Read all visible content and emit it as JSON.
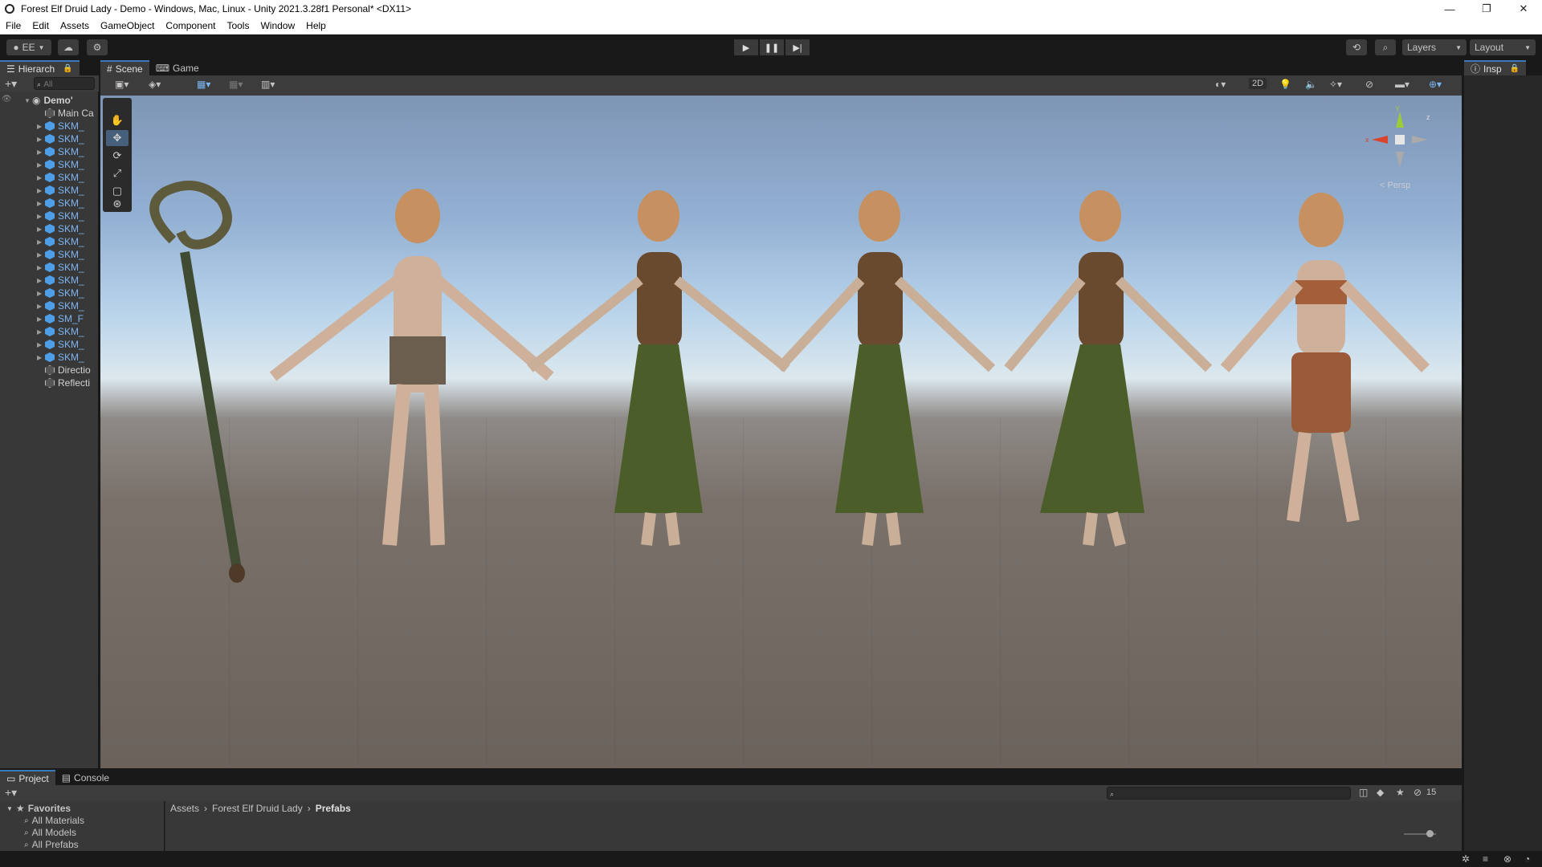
{
  "window": {
    "title": "Forest Elf Druid Lady - Demo - Windows, Mac, Linux - Unity 2021.3.28f1 Personal* <DX11>",
    "controls": [
      "—",
      "❐",
      "✕"
    ]
  },
  "menu": [
    "File",
    "Edit",
    "Assets",
    "GameObject",
    "Component",
    "Tools",
    "Window",
    "Help"
  ],
  "toolbar": {
    "account": "EE",
    "play": "▶",
    "pause": "❚❚",
    "step": "▶|",
    "layers": "Layers",
    "layout": "Layout"
  },
  "hierarchy": {
    "tab": "Hierarch",
    "search_placeholder": "All",
    "root": "Demo'",
    "items": [
      {
        "label": "Main Ca",
        "kind": "gray",
        "expandable": false
      },
      {
        "label": "SKM_",
        "kind": "blue",
        "expandable": true
      },
      {
        "label": "SKM_",
        "kind": "blue",
        "expandable": true
      },
      {
        "label": "SKM_",
        "kind": "blue",
        "expandable": true
      },
      {
        "label": "SKM_",
        "kind": "blue",
        "expandable": true
      },
      {
        "label": "SKM_",
        "kind": "blue",
        "expandable": true
      },
      {
        "label": "SKM_",
        "kind": "blue",
        "expandable": true
      },
      {
        "label": "SKM_",
        "kind": "blue",
        "expandable": true
      },
      {
        "label": "SKM_",
        "kind": "blue",
        "expandable": true
      },
      {
        "label": "SKM_",
        "kind": "blue",
        "expandable": true
      },
      {
        "label": "SKM_",
        "kind": "blue",
        "expandable": true
      },
      {
        "label": "SKM_",
        "kind": "blue",
        "expandable": true
      },
      {
        "label": "SKM_",
        "kind": "blue",
        "expandable": true
      },
      {
        "label": "SKM_",
        "kind": "blue",
        "expandable": true
      },
      {
        "label": "SKM_",
        "kind": "blue",
        "expandable": true
      },
      {
        "label": "SKM_",
        "kind": "blue",
        "expandable": true
      },
      {
        "label": "SM_F",
        "kind": "blue",
        "expandable": true
      },
      {
        "label": "SKM_",
        "kind": "blue",
        "expandable": true
      },
      {
        "label": "SKM_",
        "kind": "blue",
        "expandable": true
      },
      {
        "label": "SKM_",
        "kind": "blue",
        "expandable": true
      },
      {
        "label": "Directio",
        "kind": "gray",
        "expandable": false
      },
      {
        "label": "Reflecti",
        "kind": "gray",
        "expandable": false
      }
    ]
  },
  "scene": {
    "tabs": [
      "Scene",
      "Game"
    ],
    "active_tab": "Scene",
    "mode_2d": "2D",
    "projection": "< Persp",
    "gizmo_axes": {
      "y": "y",
      "x": "x",
      "z": "z"
    }
  },
  "inspector": {
    "tab": "Insp"
  },
  "project": {
    "tabs": [
      "Project",
      "Console"
    ],
    "active_tab": "Project",
    "favorites_title": "Favorites",
    "favorites": [
      "All Materials",
      "All Models",
      "All Prefabs"
    ],
    "breadcrumb": [
      "Assets",
      "Forest Elf Druid Lady",
      "Prefabs"
    ],
    "hidden_count": "15"
  },
  "colors": {
    "accent": "#3a79bb",
    "prefab_blue": "#7cb6f2",
    "panel": "#282828",
    "toolbar": "#191919"
  }
}
